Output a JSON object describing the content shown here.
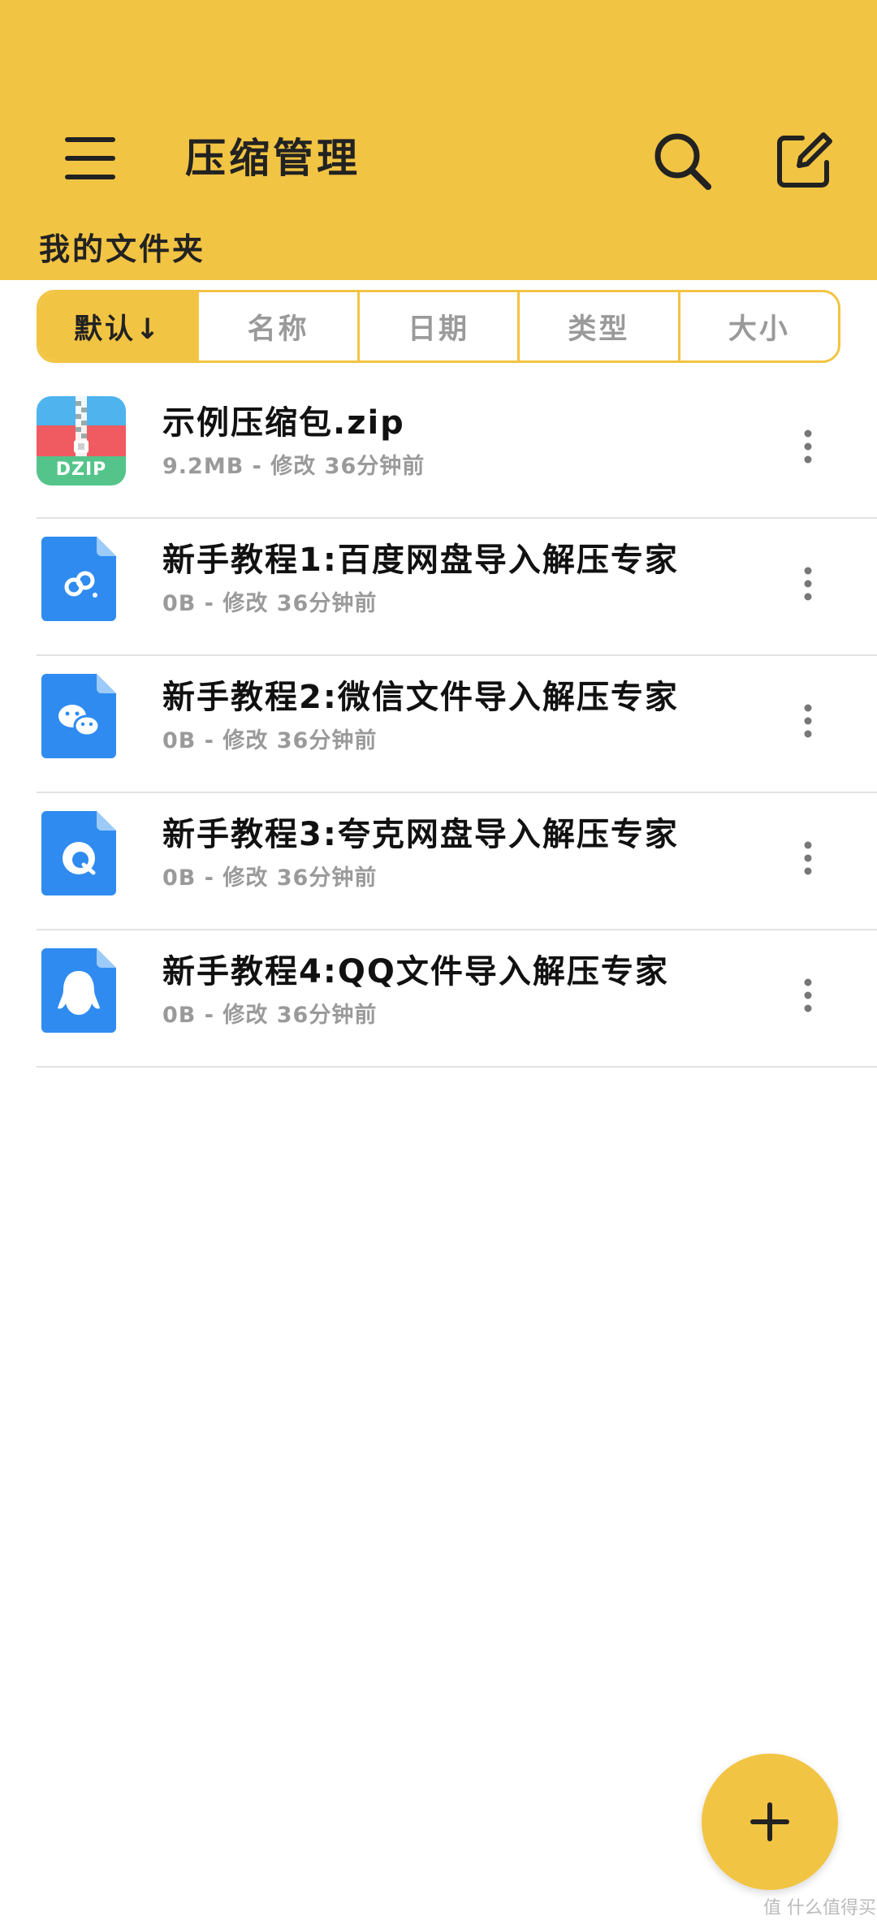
{
  "header": {
    "title": "压缩管理",
    "folder_title": "我的文件夹",
    "background_color": "#F2C443",
    "menu_icon": "hamburger-menu-icon",
    "search_icon": "search-icon",
    "edit_icon": "edit-icon"
  },
  "sort_tabs": [
    {
      "label": "默认↓",
      "active": true
    },
    {
      "label": "名称",
      "active": false
    },
    {
      "label": "日期",
      "active": false
    },
    {
      "label": "类型",
      "active": false
    },
    {
      "label": "大小",
      "active": false
    }
  ],
  "files": [
    {
      "name": "示例压缩包.zip",
      "meta": "9.2MB - 修改 36分钟前",
      "icon": "dzip-archive-icon",
      "icon_badge": "DZIP"
    },
    {
      "name": "新手教程1:百度网盘导入解压专家",
      "meta": "0B - 修改 36分钟前",
      "icon": "baidu-netdisk-file-icon"
    },
    {
      "name": "新手教程2:微信文件导入解压专家",
      "meta": "0B - 修改 36分钟前",
      "icon": "wechat-file-icon"
    },
    {
      "name": "新手教程3:夸克网盘导入解压专家",
      "meta": "0B - 修改 36分钟前",
      "icon": "quark-netdisk-file-icon"
    },
    {
      "name": "新手教程4:QQ文件导入解压专家",
      "meta": "0B - 修改 36分钟前",
      "icon": "qq-file-icon"
    }
  ],
  "fab": {
    "icon": "plus-icon"
  },
  "watermark": "值 什么值得买"
}
